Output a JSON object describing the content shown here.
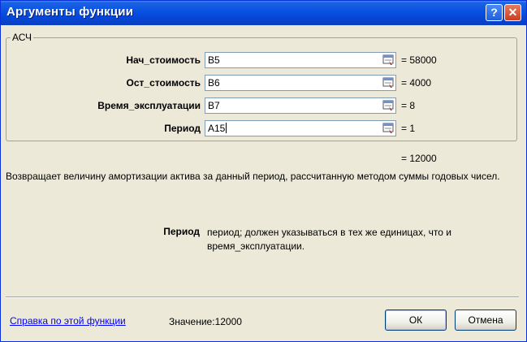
{
  "window": {
    "title": "Аргументы функции",
    "help_glyph": "?",
    "close_glyph": "✕"
  },
  "group": {
    "label": "АСЧ"
  },
  "arguments": [
    {
      "label": "Нач_стоимость",
      "value": "B5",
      "result": "= 58000"
    },
    {
      "label": "Ост_стоимость",
      "value": "B6",
      "result": "= 4000"
    },
    {
      "label": "Время_эксплуатации",
      "value": "B7",
      "result": "= 8"
    },
    {
      "label": "Период",
      "value": "A15",
      "result": "= 1"
    }
  ],
  "formula_result": "= 12000",
  "description": "Возвращает величину амортизации актива за данный период, рассчитанную методом суммы годовых чисел.",
  "parameter": {
    "name": "Период",
    "line1": "период; должен указываться в тех же единицах, что и",
    "line2": "время_эксплуатации."
  },
  "footer": {
    "help_link": "Справка по этой функции",
    "value_label": "Значение:",
    "value": "12000",
    "ok_label": "ОК",
    "cancel_label": "Отмена"
  }
}
